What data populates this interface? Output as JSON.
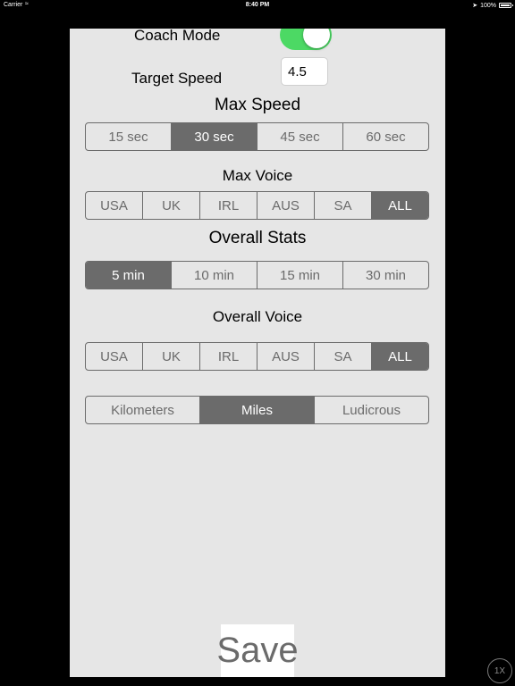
{
  "status_bar": {
    "carrier": "Carrier",
    "wifi_icon": "wifi-icon",
    "time": "8:40 PM",
    "location_icon": "location-arrow-icon",
    "battery": "100%",
    "battery_level": 1.0
  },
  "coach_mode": {
    "label": "Coach Mode",
    "enabled": true,
    "toggle_color": "#4cd964"
  },
  "target_speed": {
    "label": "Target Speed",
    "value": "4.5"
  },
  "max_speed": {
    "heading": "Max Speed",
    "options": [
      "15 sec",
      "30 sec",
      "45 sec",
      "60 sec"
    ],
    "selected": "30 sec"
  },
  "max_voice": {
    "heading": "Max Voice",
    "options": [
      "USA",
      "UK",
      "IRL",
      "AUS",
      "SA",
      "ALL"
    ],
    "selected": "ALL"
  },
  "overall_stats": {
    "heading": "Overall Stats",
    "options": [
      "5 min",
      "10 min",
      "15 min",
      "30 min"
    ],
    "selected": "5 min"
  },
  "overall_voice": {
    "heading": "Overall Voice",
    "options": [
      "USA",
      "UK",
      "IRL",
      "AUS",
      "SA",
      "ALL"
    ],
    "selected": "ALL"
  },
  "units": {
    "options": [
      "Kilometers",
      "Miles",
      "Ludicrous"
    ],
    "selected": "Miles"
  },
  "save_label": "Save",
  "zoom_label": "1X",
  "colors": {
    "segment_tint": "#6b6b6b",
    "panel_background": "#e6e6e6",
    "screen_background": "#000000"
  }
}
